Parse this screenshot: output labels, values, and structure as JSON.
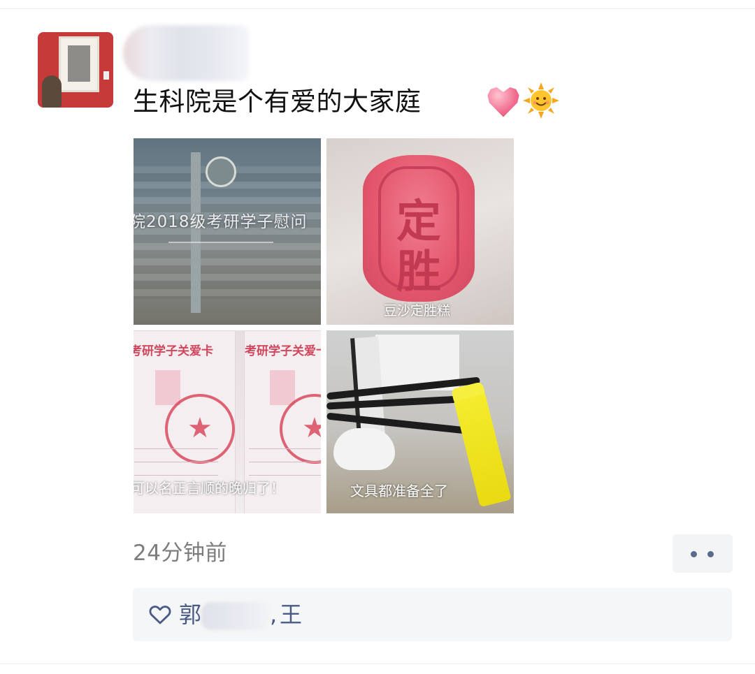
{
  "post": {
    "text": "生科院是个有爱的大家庭",
    "emojis": [
      "heart-emoji",
      "smiling-sun-emoji"
    ]
  },
  "photos": [
    {
      "name": "photo-banner",
      "overlay_text": "院2018级考研学子慰问"
    },
    {
      "name": "photo-cake",
      "cake_chars": [
        "定",
        "胜"
      ],
      "caption": "豆沙定胜糕"
    },
    {
      "name": "photo-cards",
      "header_text": "考研学子关爱卡",
      "caption": "可以名正言顺的晚归了！"
    },
    {
      "name": "photo-stationery",
      "caption": "文具都准备全了"
    }
  ],
  "meta": {
    "timestamp": "24分钟前",
    "more_icon": "more-dots-icon"
  },
  "likes": {
    "icon": "heart-outline-icon",
    "first_name_visible": "郭",
    "second_name_visible": "王",
    "separator": ","
  },
  "colors": {
    "like_name": "#4b5a85",
    "timestamp": "#7d7d7d",
    "likes_bg": "#f5f6f7"
  }
}
